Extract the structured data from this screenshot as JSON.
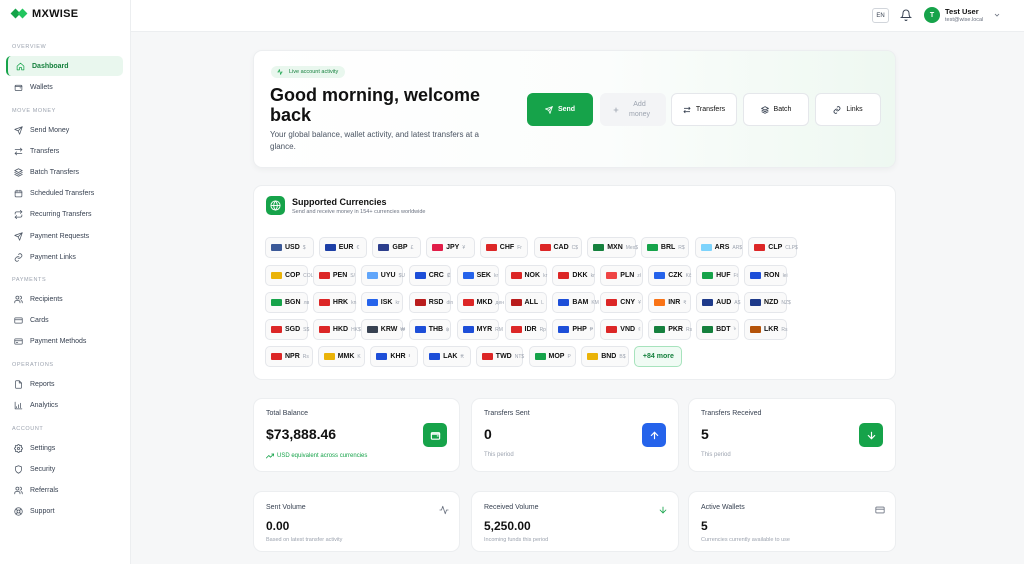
{
  "app": {
    "logo_text": "MXWISE"
  },
  "sidebar": {
    "sections": [
      {
        "title": "OVERVIEW",
        "items": [
          {
            "label": "Dashboard",
            "icon": "home-icon"
          },
          {
            "label": "Wallets",
            "icon": "wallet-icon"
          }
        ]
      },
      {
        "title": "MOVE MONEY",
        "items": [
          {
            "label": "Send Money",
            "icon": "send-icon"
          },
          {
            "label": "Transfers",
            "icon": "transfer-icon"
          },
          {
            "label": "Batch Transfers",
            "icon": "layers-icon"
          },
          {
            "label": "Scheduled Transfers",
            "icon": "calendar-icon"
          },
          {
            "label": "Recurring Transfers",
            "icon": "repeat-icon"
          },
          {
            "label": "Payment Requests",
            "icon": "request-icon"
          },
          {
            "label": "Payment Links",
            "icon": "link-icon"
          }
        ]
      },
      {
        "title": "PAYMENTS",
        "items": [
          {
            "label": "Recipients",
            "icon": "users-icon"
          },
          {
            "label": "Cards",
            "icon": "card-icon"
          },
          {
            "label": "Payment Methods",
            "icon": "credit-card-icon"
          }
        ]
      },
      {
        "title": "OPERATIONS",
        "items": [
          {
            "label": "Reports",
            "icon": "report-icon"
          },
          {
            "label": "Analytics",
            "icon": "chart-icon"
          }
        ]
      },
      {
        "title": "ACCOUNT",
        "items": [
          {
            "label": "Settings",
            "icon": "gear-icon"
          },
          {
            "label": "Security",
            "icon": "shield-icon"
          },
          {
            "label": "Referrals",
            "icon": "users-icon"
          },
          {
            "label": "Support",
            "icon": "lifebuoy-icon"
          }
        ]
      }
    ]
  },
  "topbar": {
    "lang": "EN",
    "user_initial": "T",
    "user_name": "Test User",
    "user_email": "test@wise.local"
  },
  "hero": {
    "badge": "Live account activity",
    "title": "Good morning, welcome back",
    "subtitle": "Your global balance, wallet activity, and latest transfers at a glance.",
    "buttons": {
      "send": "Send",
      "add_money": "Add money",
      "transfers": "Transfers",
      "batch": "Batch",
      "links": "Links"
    }
  },
  "currencies": {
    "title": "Supported Currencies",
    "subtitle": "Send and receive money in 154+ currencies worldwide",
    "more": "+84 more",
    "rows": [
      [
        [
          "USD",
          "$",
          "#3b5998"
        ],
        [
          "EUR",
          "€",
          "#1d3fa6"
        ],
        [
          "GBP",
          "£",
          "#2c3e8c"
        ],
        [
          "JPY",
          "¥",
          "#e11d48"
        ],
        [
          "CHF",
          "Fr",
          "#dc2626"
        ],
        [
          "CAD",
          "C$",
          "#dc2626"
        ],
        [
          "MXN",
          "Mex$",
          "#15803d"
        ],
        [
          "BRL",
          "R$",
          "#16a34a"
        ],
        [
          "ARS",
          "AR$",
          "#7dd3fc"
        ],
        [
          "CLP",
          "CLP$",
          "#dc2626"
        ]
      ],
      [
        [
          "COP",
          "COL$",
          "#eab308"
        ],
        [
          "PEN",
          "S/",
          "#dc2626"
        ],
        [
          "UYU",
          "$U",
          "#60a5fa"
        ],
        [
          "CRC",
          "₡",
          "#1d4ed8"
        ],
        [
          "SEK",
          "kr",
          "#2563eb"
        ],
        [
          "NOK",
          "kr",
          "#dc2626"
        ],
        [
          "DKK",
          "kr",
          "#dc2626"
        ],
        [
          "PLN",
          "zł",
          "#ef4444"
        ],
        [
          "CZK",
          "Kč",
          "#2563eb"
        ],
        [
          "HUF",
          "Ft",
          "#16a34a"
        ],
        [
          "RON",
          "lei",
          "#1d4ed8"
        ]
      ],
      [
        [
          "BGN",
          "лв",
          "#16a34a"
        ],
        [
          "HRK",
          "kn",
          "#dc2626"
        ],
        [
          "ISK",
          "kr",
          "#2563eb"
        ],
        [
          "RSD",
          "din",
          "#b91c1c"
        ],
        [
          "MKD",
          "ден",
          "#dc2626"
        ],
        [
          "ALL",
          "L",
          "#b91c1c"
        ],
        [
          "BAM",
          "KM",
          "#1d4ed8"
        ],
        [
          "CNY",
          "¥",
          "#dc2626"
        ],
        [
          "INR",
          "₹",
          "#f97316"
        ],
        [
          "AUD",
          "A$",
          "#1e3a8a"
        ],
        [
          "NZD",
          "NZ$",
          "#1e3a8a"
        ]
      ],
      [
        [
          "SGD",
          "S$",
          "#dc2626"
        ],
        [
          "HKD",
          "HK$",
          "#dc2626"
        ],
        [
          "KRW",
          "₩",
          "#374151"
        ],
        [
          "THB",
          "฿",
          "#1d4ed8"
        ],
        [
          "MYR",
          "RM",
          "#1d4ed8"
        ],
        [
          "IDR",
          "Rp",
          "#dc2626"
        ],
        [
          "PHP",
          "₱",
          "#1d4ed8"
        ],
        [
          "VND",
          "₫",
          "#dc2626"
        ],
        [
          "PKR",
          "Rs",
          "#15803d"
        ],
        [
          "BDT",
          "৳",
          "#15803d"
        ],
        [
          "LKR",
          "Rs",
          "#b45309"
        ]
      ],
      [
        [
          "NPR",
          "Rs",
          "#dc2626"
        ],
        [
          "MMK",
          "K",
          "#eab308"
        ],
        [
          "KHR",
          "៛",
          "#1d4ed8"
        ],
        [
          "LAK",
          "₭",
          "#1d4ed8"
        ],
        [
          "TWD",
          "NT$",
          "#dc2626"
        ],
        [
          "MOP",
          "P",
          "#16a34a"
        ],
        [
          "BND",
          "B$",
          "#eab308"
        ]
      ]
    ]
  },
  "stats_top": [
    {
      "label": "Total Balance",
      "value": "$73,888.46",
      "note": "USD equivalent across currencies",
      "icon": "wallet-icon",
      "color": "#16a34a"
    },
    {
      "label": "Transfers Sent",
      "value": "0",
      "note": "This period",
      "icon": "arrow-up-icon",
      "color": "#2563eb"
    },
    {
      "label": "Transfers Received",
      "value": "5",
      "note": "This period",
      "icon": "arrow-down-icon",
      "color": "#16a34a"
    }
  ],
  "stats_bottom": [
    {
      "label": "Sent Volume",
      "value": "0.00",
      "note": "Based on latest transfer activity",
      "icon": "activity-icon"
    },
    {
      "label": "Received Volume",
      "value": "5,250.00",
      "note": "Incoming funds this period",
      "icon": "arrow-down-icon"
    },
    {
      "label": "Active Wallets",
      "value": "5",
      "note": "Currencies currently available to use",
      "icon": "card-icon"
    }
  ]
}
